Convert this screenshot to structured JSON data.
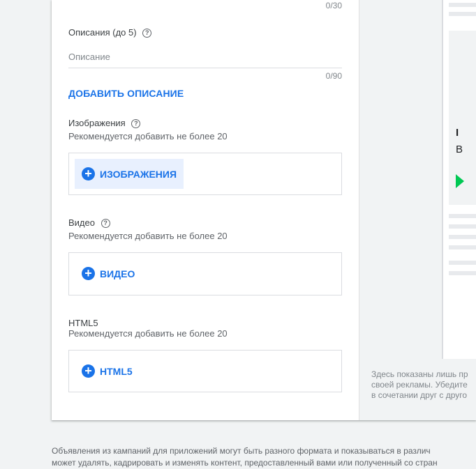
{
  "headline_counter": "0/30",
  "descriptions": {
    "label": "Описания (до 5)",
    "placeholder": "Описание",
    "counter": "0/90",
    "add_button": "ДОБАВИТЬ ОПИСАНИЕ"
  },
  "images": {
    "label": "Изображения",
    "hint": "Рекомендуется добавить не более 20",
    "button": "ИЗОБРАЖЕНИЯ"
  },
  "video": {
    "label": "Видео",
    "hint": "Рекомендуется добавить не более 20",
    "button": "ВИДЕО"
  },
  "html5": {
    "label": "HTML5",
    "hint": "Рекомендуется добавить не более 20",
    "button": "HTML5"
  },
  "preview": {
    "text_line1": "I",
    "text_line2": "B",
    "disclaimer": [
      "Здесь показаны лишь пр",
      "своей рекламы. Убедите",
      "в сочетании друг с друго"
    ]
  },
  "footer": [
    "Объявления из кампаний для приложений могут быть разного формата и показываться в различ",
    "может удалять, кадрировать и изменять контент, предоставленный вами или полученный со стран"
  ],
  "icons": {
    "help": "help-circle-icon",
    "add": "plus-circle-icon",
    "play": "google-play-icon"
  },
  "colors": {
    "accent": "#1a73e8",
    "button_hover_bg": "#e8f0fe",
    "page_bg": "#f1f3f4"
  }
}
